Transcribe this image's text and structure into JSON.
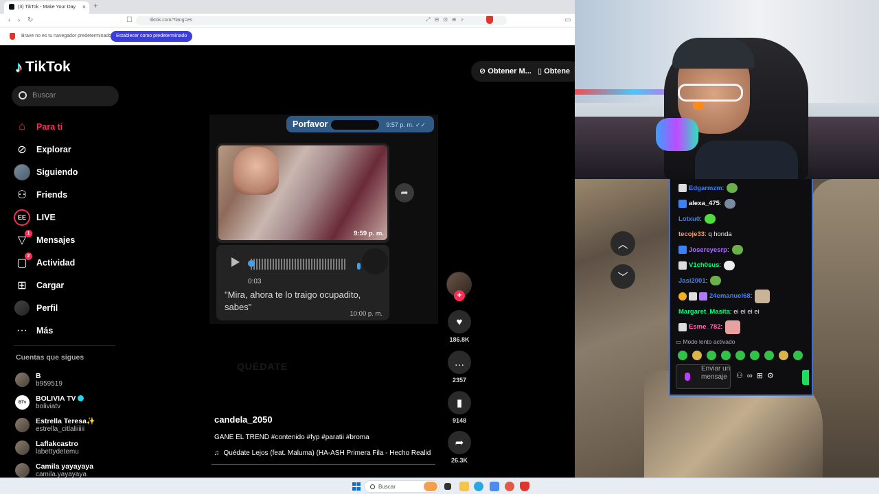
{
  "browser": {
    "tab_title": "(3) TikTok - Make Your Day",
    "url": "tiktok.com/?lang=es",
    "notification_text": "Brave no es tu navegador predeterminado",
    "notification_button": "Establecer como predeterminado"
  },
  "tiktok": {
    "logo_text": "TikTok",
    "search_placeholder": "Buscar",
    "get_app_label": "Obtener M...",
    "get_app_label_2": "Obtene",
    "nav": [
      {
        "label": "Para ti",
        "icon": "home-icon",
        "active": true
      },
      {
        "label": "Explorar",
        "icon": "compass-icon"
      },
      {
        "label": "Siguiendo",
        "icon": "avatar-icon"
      },
      {
        "label": "Friends",
        "icon": "friends-icon"
      },
      {
        "label": "LIVE",
        "icon": "live-icon",
        "badge_text": "EE"
      },
      {
        "label": "Mensajes",
        "icon": "messages-icon",
        "badge": "1"
      },
      {
        "label": "Actividad",
        "icon": "activity-icon",
        "badge": "2"
      },
      {
        "label": "Cargar",
        "icon": "upload-icon"
      },
      {
        "label": "Perfil",
        "icon": "profile-icon"
      },
      {
        "label": "Más",
        "icon": "more-icon"
      }
    ],
    "following_title": "Cuentas que sigues",
    "following": [
      {
        "name": "B",
        "user": "b959519"
      },
      {
        "name": "BOLIVIA TV",
        "user": "boliviatv",
        "verified": true,
        "avatar_text": "BTv"
      },
      {
        "name": "Estrella Teresa✨",
        "user": "estrella_citlaliiiiii"
      },
      {
        "name": "Laflakcastro",
        "user": "labettydetemu"
      },
      {
        "name": "Camila yayayaya",
        "user": "camila.yayayaya"
      }
    ],
    "video": {
      "message_out": "Porfavor",
      "message_out_time": "9:57 p. m.",
      "photo_time": "9:59 p. m.",
      "audio_duration": "0:03",
      "audio_caption": "\"Mira, ahora te lo traigo ocupadito, sabes\"",
      "audio_time": "10:00 p. m.",
      "overlay_text": "QUÉDATE"
    },
    "author": "candela_2050",
    "description": "GANE EL TREND #contenido #fyp #paratii #broma",
    "music": "Quédate Lejos (feat. Maluma) (HA-ASH Primera Fila - Hecho Realidad)",
    "actions": {
      "likes": "186.8K",
      "comments": "2357",
      "saves": "9148",
      "shares": "26.3K"
    }
  },
  "chat": {
    "messages": [
      {
        "user": "Edgarmzm",
        "text": "",
        "color": "#3b82f6",
        "emote": true
      },
      {
        "user": "alexa_475",
        "text": "",
        "color": "#ffffff",
        "emote": true
      },
      {
        "user": "Lotxu0",
        "text": "",
        "color": "#3b82f6",
        "emote": true
      },
      {
        "user": "tecoje33",
        "text": "q honda",
        "color": "#ff9d5c"
      },
      {
        "user": "Josereyesrp",
        "text": "",
        "color": "#a970ff",
        "emote": true
      },
      {
        "user": "V1ch0sus",
        "text": "",
        "color": "#00ff7f",
        "emote": true
      },
      {
        "user": "Jasi2001",
        "text": "",
        "color": "#3b82f6",
        "emote": true
      },
      {
        "user": "24emanuel68",
        "text": "",
        "color": "#3b82f6",
        "emote": true
      },
      {
        "user": "Margaret_Masita",
        "text": "ei ei ei ei",
        "color": "#00ff7f"
      },
      {
        "user": "Esme_782",
        "text": "",
        "color": "#ff69b4",
        "emote": true
      }
    ],
    "slow_mode": "Modo lento activado",
    "input_placeholder": "Enviar un mensaje"
  },
  "taskbar": {
    "search_placeholder": "Buscar"
  }
}
